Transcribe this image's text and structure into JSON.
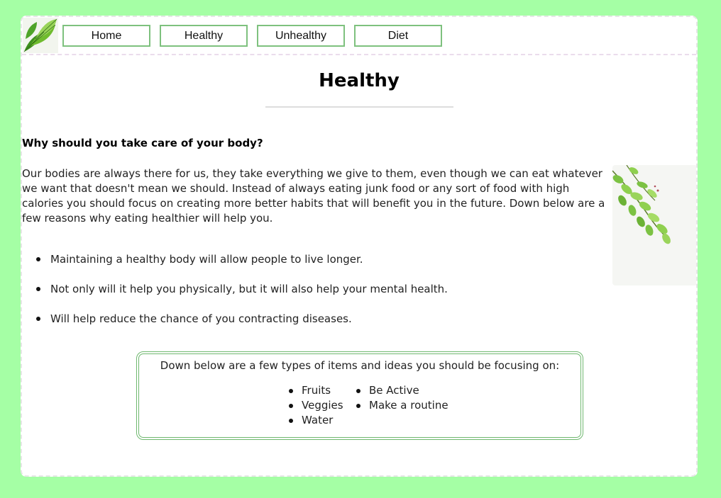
{
  "nav": {
    "items": [
      "Home",
      "Healthy",
      "Unhealthy",
      "Diet"
    ]
  },
  "main": {
    "title": "Healthy",
    "heading": "Why should you take care of your body?",
    "intro": "Our bodies are always there for us, they take everything we give to them, even though we can eat whatever we want that doesn't mean we should. Instead of always eating junk food or any sort of food with high calories you should focus on creating more better habits that will benefit you in the future. Down below are a few reasons why eating healthier will help you.",
    "reasons": [
      "Maintaining a healthy body will allow people to live longer.",
      "Not only will it help you physically, but it will also help your mental health.",
      "Will help reduce the chance of you contracting diseases."
    ]
  },
  "focus": {
    "text": "Down below are a few types of items and ideas you should be focusing on:",
    "col1": [
      "Fruits",
      "Veggies",
      "Water"
    ],
    "col2": [
      "Be Active",
      "Make a routine"
    ]
  },
  "colors": {
    "background": "#a5ffa5",
    "accent_border": "#7ec17e",
    "leaf": "#7cc243"
  },
  "icons": {
    "logo": "leaf-logo-icon",
    "side_image": "leaf-branch-image"
  }
}
